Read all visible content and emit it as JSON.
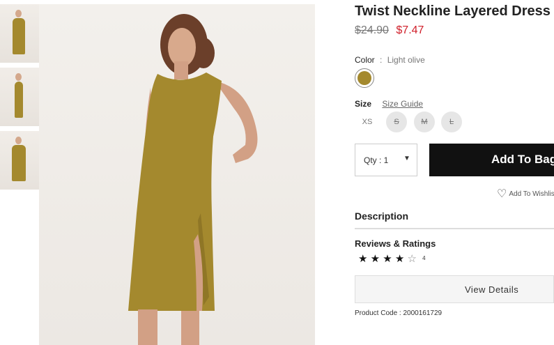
{
  "product": {
    "title": "Twist Neckline Layered Dress",
    "old_price": "$24.90",
    "new_price": "$7.47",
    "product_code": "Product Code : 2000161729"
  },
  "color": {
    "label": "Color",
    "separator": ":",
    "value": "Light olive",
    "swatch_hex": "#a4892e"
  },
  "size": {
    "label": "Size",
    "guide_label": "Size Guide",
    "options": [
      {
        "label": "XS",
        "available": true
      },
      {
        "label": "S",
        "available": false
      },
      {
        "label": "M",
        "available": false
      },
      {
        "label": "L",
        "available": false
      }
    ]
  },
  "cart": {
    "qty_label": "Qty : 1",
    "add_label": "Add To Bag",
    "wishlist_label": "Add To Wishlist"
  },
  "sections": {
    "description": "Description",
    "reviews": "Reviews & Ratings",
    "rating": "4",
    "rating_count": "4",
    "view_details": "View Details"
  },
  "colors": {
    "price_sale": "#d0202b",
    "button_bg": "#111111",
    "dress": "#a4892e"
  }
}
